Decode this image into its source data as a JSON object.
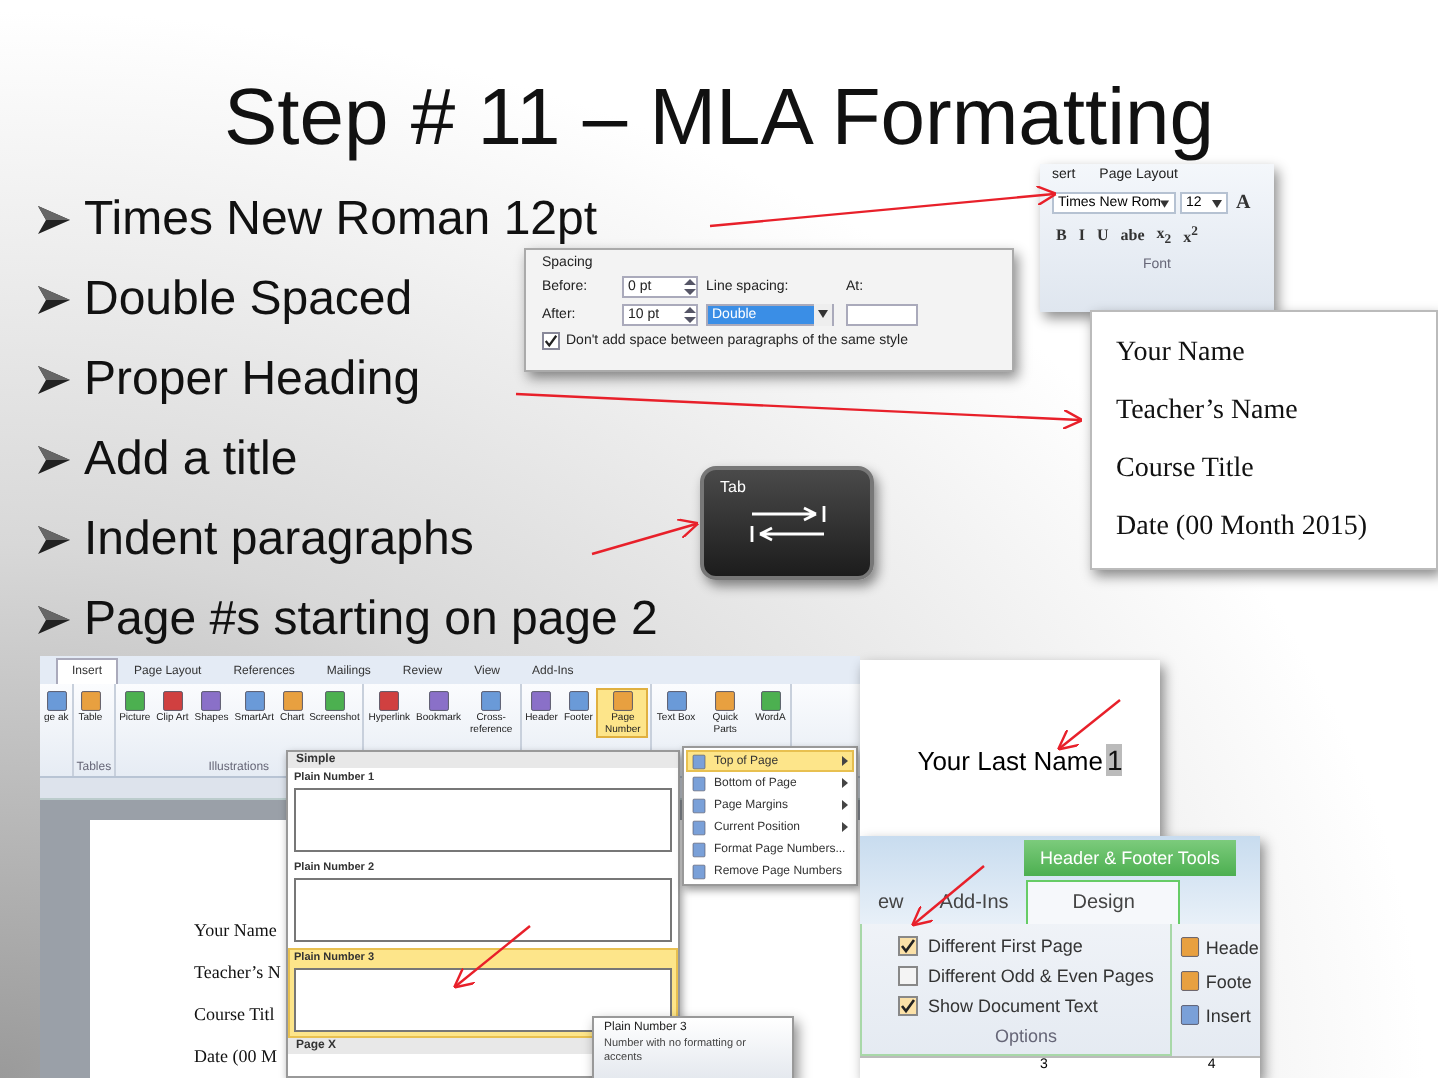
{
  "slide": {
    "title": "Step # 11 – MLA Formatting",
    "bullets": [
      "Times New Roman 12pt",
      "Double Spaced",
      "Proper Heading",
      "Add a title",
      "Indent paragraphs",
      "Page #s starting on page 2"
    ]
  },
  "font_ribbon": {
    "tabs": [
      "sert",
      "Page Layout"
    ],
    "font_name": "Times New Rom",
    "font_size": "12",
    "grow_font": "A",
    "format_buttons": [
      "B",
      "I",
      "U",
      "abe",
      "x$_{2}$",
      "x$^{2}$"
    ],
    "group_label": "Font"
  },
  "spacing_dialog": {
    "section": "Spacing",
    "before_label": "Before:",
    "before_value": "0 pt",
    "after_label": "After:",
    "after_value": "10 pt",
    "line_spacing_label": "Line spacing:",
    "line_spacing_value": "Double",
    "at_label": "At:",
    "option": {
      "label": "Don't add space between paragraphs of the same style",
      "checked": true
    }
  },
  "heading_card": {
    "lines": [
      "Your Name",
      "Teacher’s Name",
      "Course Title",
      "Date (00 Month 2015)"
    ]
  },
  "tab_key": {
    "label": "Tab"
  },
  "word_window": {
    "tabs": [
      {
        "label": "Insert",
        "selected": true
      },
      {
        "label": "Page Layout",
        "selected": false
      },
      {
        "label": "References",
        "selected": false
      },
      {
        "label": "Mailings",
        "selected": false
      },
      {
        "label": "Review",
        "selected": false
      },
      {
        "label": "View",
        "selected": false
      },
      {
        "label": "Add-Ins",
        "selected": false
      }
    ],
    "groups": [
      {
        "items": [
          {
            "label": "ge ak",
            "selected": false
          }
        ]
      },
      {
        "label": "Tables",
        "items": [
          {
            "label": "Table",
            "selected": false
          }
        ]
      },
      {
        "label": "Illustrations",
        "items": [
          {
            "label": "Picture",
            "selected": false
          },
          {
            "label": "Clip Art",
            "selected": false
          },
          {
            "label": "Shapes",
            "selected": false
          },
          {
            "label": "SmartArt",
            "selected": false
          },
          {
            "label": "Chart",
            "selected": false
          },
          {
            "label": "Screenshot",
            "selected": false
          }
        ]
      },
      {
        "items": [
          {
            "label": "Hyperlink",
            "selected": false
          },
          {
            "label": "Bookmark",
            "selected": false
          },
          {
            "label": "Cross-reference",
            "selected": false
          }
        ]
      },
      {
        "items": [
          {
            "label": "Header",
            "selected": false
          },
          {
            "label": "Footer",
            "selected": false
          },
          {
            "label": "Page Number",
            "selected": true
          }
        ]
      },
      {
        "items": [
          {
            "label": "Text Box",
            "selected": false
          },
          {
            "label": "Quick Parts",
            "selected": false
          },
          {
            "label": "WordA",
            "selected": false
          }
        ]
      }
    ],
    "document_lines": [
      "Your Name",
      "Teacher’s N",
      "Course Titl",
      "Date (00 M"
    ]
  },
  "page_number_gallery": {
    "section": "Simple",
    "items": [
      {
        "label": "Plain Number 1",
        "selected": false
      },
      {
        "label": "Plain Number 2",
        "selected": false
      },
      {
        "label": "Plain Number 3",
        "selected": true
      }
    ],
    "next_section": "Page X"
  },
  "page_number_menu": [
    {
      "label": "Top of Page",
      "selected": true,
      "submenu": true
    },
    {
      "label": "Bottom of Page",
      "selected": false,
      "submenu": true
    },
    {
      "label": "Page Margins",
      "selected": false,
      "submenu": true
    },
    {
      "label": "Current Position",
      "selected": false,
      "submenu": true
    },
    {
      "label": "Format Page Numbers...",
      "selected": false,
      "submenu": false
    },
    {
      "label": "Remove Page Numbers",
      "selected": false,
      "submenu": false
    }
  ],
  "tooltip": {
    "title": "Plain Number 3",
    "text": "Number with no formatting or accents"
  },
  "header_page": {
    "text": "Your Last Name",
    "page_number": "1"
  },
  "header_footer_tools": {
    "context_label": "Header & Footer Tools",
    "tabs": [
      {
        "label": "ew",
        "selected": false
      },
      {
        "label": "Add-Ins",
        "selected": false
      },
      {
        "label": "Design",
        "selected": true
      }
    ],
    "options": [
      {
        "label": "Different First Page",
        "checked": true
      },
      {
        "label": "Different Odd & Even Pages",
        "checked": false
      },
      {
        "label": "Show Document Text",
        "checked": true
      }
    ],
    "group_label": "Options",
    "commands": [
      "Heade",
      "Foote",
      "Insert"
    ],
    "ruler_numbers": [
      "3",
      "4"
    ]
  }
}
